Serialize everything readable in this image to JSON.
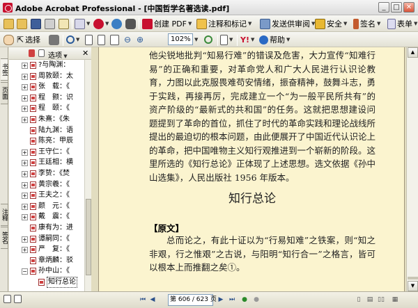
{
  "window": {
    "title": "Adobe Acrobat Professional - [中国哲学名著选读.pdf]",
    "controls": {
      "minimize": "_",
      "maximize": "□",
      "close": "✕"
    }
  },
  "toolbar1": {
    "create_pdf": "创建 PDF",
    "comment": "注释和标记",
    "send_review": "发送供审阅",
    "security": "安全",
    "sign": "签名",
    "forms": "表单"
  },
  "toolbar2": {
    "select": "选择",
    "zoom": "102%",
    "help": "帮助"
  },
  "left_tabs": {
    "bookmarks": "书签",
    "pages": "页面",
    "annotations": "注释",
    "signatures": "签名"
  },
  "panel": {
    "options": "选项"
  },
  "bookmarks": [
    {
      "label": "?与陶渊：",
      "expand": "+"
    },
    {
      "label": "周敦颐：太",
      "expand": "+"
    },
    {
      "label": "张　载：《",
      "expand": "+"
    },
    {
      "label": "程　颢：识",
      "expand": "+"
    },
    {
      "label": "程　颐：《",
      "expand": "+"
    },
    {
      "label": "朱熹：《朱",
      "expand": "+"
    },
    {
      "label": "陆九渊：语",
      "expand": ""
    },
    {
      "label": "陈亮：甲辰",
      "expand": ""
    },
    {
      "label": "王守仁：《",
      "expand": "+"
    },
    {
      "label": "王廷相：横",
      "expand": "+"
    },
    {
      "label": "李贽：《焚",
      "expand": "+"
    },
    {
      "label": "黄宗羲：《",
      "expand": "+"
    },
    {
      "label": "王夫之：《",
      "expand": "+"
    },
    {
      "label": "颜　元：《",
      "expand": "+"
    },
    {
      "label": "戴　震：《",
      "expand": "+"
    },
    {
      "label": "康有为：进",
      "expand": ""
    },
    {
      "label": "谭嗣同：《",
      "expand": "+"
    },
    {
      "label": "严　复：《",
      "expand": "+"
    },
    {
      "label": "章炳麟：驳",
      "expand": ""
    },
    {
      "label": "孙中山：《",
      "expand": "−"
    },
    {
      "label": "知行总论",
      "expand": ""
    }
  ],
  "document": {
    "para1": "他尖锐地批判“知易行难”的错误及危害，大力宣传“知难行易”的正确和重要，对革命党人和广大人民进行认识论教育，力图以此克服畏难苟安情绪，振奋精神，鼓舞斗志，勇于实践，再接再厉，完成建立一个“为一般平民所共有”的资产阶级的“最新式的共和国”的任务。这就把思想建设问题提到了革命的首位，抓住了时代的革命实践和理论战线所提出的最迫切的根本问题，由此便展开了中国近代认识论上的革命，把中国唯物主义知行观推进到一个崭新的阶段。这里所选的《知行总论》正体现了上述思想。选文依据《孙中山选集》，人民出版社 1956 年版本。",
    "heading": "知行总论",
    "label": "【原文】",
    "para2": "总而论之，有此十证以为“行易知难”之铁案，则“知之非艰，行之惟艰”之古说，与阳明“知行合一”之格言，皆可以根本上而推翻之矣①。"
  },
  "status": {
    "page_current": "606",
    "page_text": "第 606 / 623 页"
  }
}
